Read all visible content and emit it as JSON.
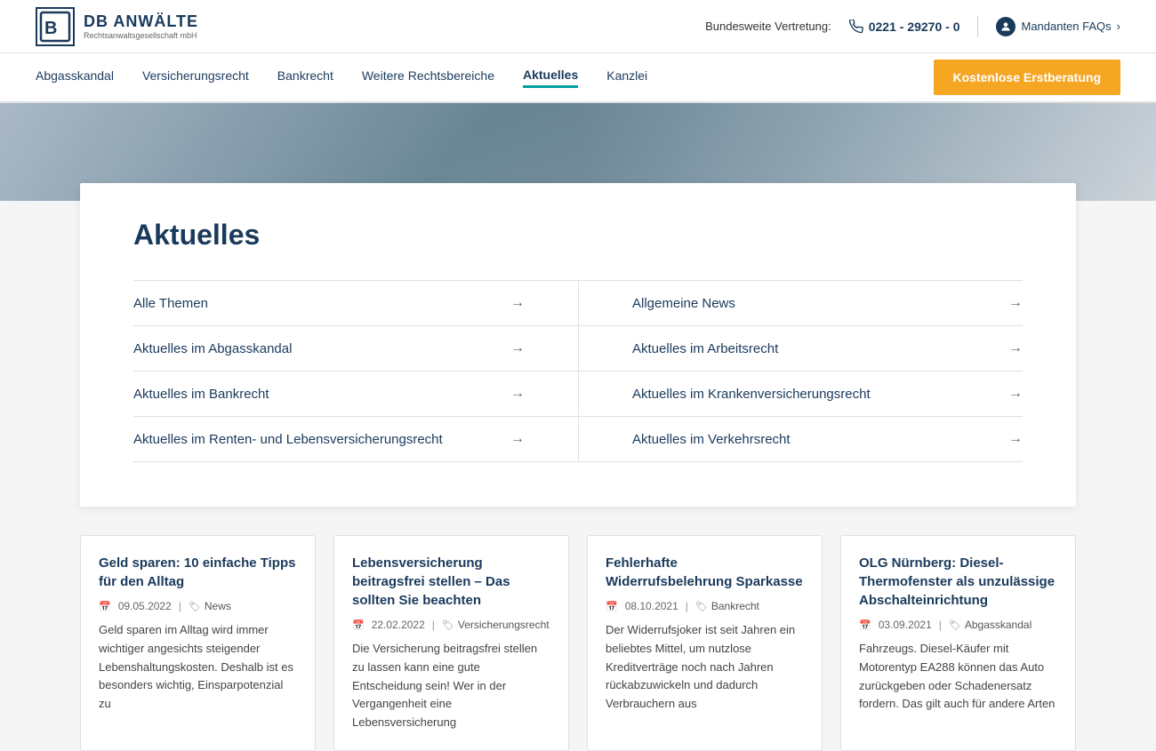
{
  "header": {
    "logo_letter": "B",
    "logo_title": "DB ANWÄLTE",
    "logo_subtitle": "Rechtsanwaltsgesellschaft mbH",
    "bundesweite_label": "Bundesweite Vertretung:",
    "phone_number": "0221 - 29270 - 0",
    "mandanten_faq": "Mandanten FAQs"
  },
  "nav": {
    "items": [
      {
        "label": "Abgasskandal",
        "active": false
      },
      {
        "label": "Versicherungsrecht",
        "active": false
      },
      {
        "label": "Bankrecht",
        "active": false
      },
      {
        "label": "Weitere Rechtsbereiche",
        "active": false
      },
      {
        "label": "Aktuelles",
        "active": true
      },
      {
        "label": "Kanzlei",
        "active": false
      }
    ],
    "cta_label": "Kostenlose Erstberatung"
  },
  "aktuelles": {
    "page_title": "Aktuelles",
    "menu_items": [
      {
        "label": "Alle Themen",
        "col": "left"
      },
      {
        "label": "Allgemeine News",
        "col": "right"
      },
      {
        "label": "Aktuelles im Abgasskandal",
        "col": "left"
      },
      {
        "label": "Aktuelles im Arbeitsrecht",
        "col": "right"
      },
      {
        "label": "Aktuelles im Bankrecht",
        "col": "left"
      },
      {
        "label": "Aktuelles im Krankenversicherungsrecht",
        "col": "right"
      },
      {
        "label": "Aktuelles im Renten- und Lebensversicherungsrecht",
        "col": "left"
      },
      {
        "label": "Aktuelles im Verkehrsrecht",
        "col": "right"
      }
    ]
  },
  "cards": [
    {
      "title": "Geld sparen: 10 einfache Tipps für den Alltag",
      "date": "09.05.2022",
      "tag": "News",
      "text": "Geld sparen im Alltag wird immer wichtiger angesichts steigender Lebenshaltungskosten. Deshalb ist es besonders wichtig, Einsparpotenzial zu"
    },
    {
      "title": "Lebensversicherung beitragsfrei stellen – Das sollten Sie beachten",
      "date": "22.02.2022",
      "tag": "Versicherungsrecht",
      "text": "Die Versicherung beitragsfrei stellen zu lassen kann eine gute Entscheidung sein!\n\nWer in der Vergangenheit eine Lebensversicherung"
    },
    {
      "title": "Fehlerhafte Widerrufsbelehrung Sparkasse",
      "date": "08.10.2021",
      "tag": "Bankrecht",
      "text": "Der Widerrufsjoker ist seit Jahren ein beliebtes Mittel, um nutzlose Kreditverträge noch nach Jahren rückabzuwickeln und dadurch Verbrauchern aus"
    },
    {
      "title": "OLG Nürnberg: Diesel-Thermofenster als unzulässige Abschalteinrichtung",
      "date": "03.09.2021",
      "tag": "Abgasskandal",
      "text": "Fahrzeugs. Diesel-Käufer mit Motorentyp EA288 können das Auto zurückgeben oder Schadenersatz fordern. Das gilt auch für andere Arten"
    }
  ]
}
